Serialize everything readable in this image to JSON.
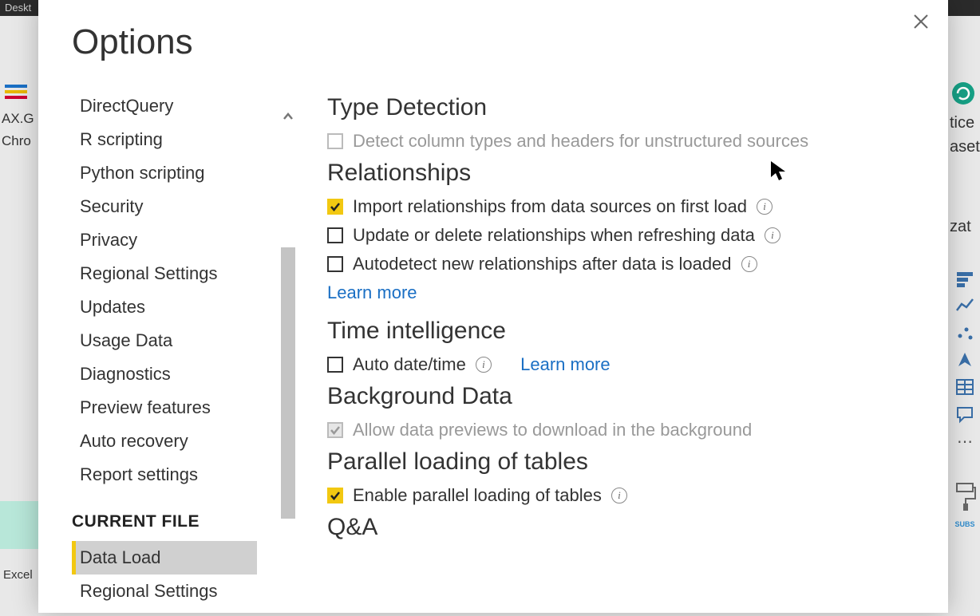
{
  "bg": {
    "titlebar": "Deskt",
    "left_lines": [
      "AX.G",
      "Chro"
    ],
    "excel_label": "Excel",
    "right_lines": [
      "tice",
      "aset",
      "zat"
    ]
  },
  "dialog": {
    "title": "Options",
    "sidebar": {
      "items": [
        "DirectQuery",
        "R scripting",
        "Python scripting",
        "Security",
        "Privacy",
        "Regional Settings",
        "Updates",
        "Usage Data",
        "Diagnostics",
        "Preview features",
        "Auto recovery",
        "Report settings"
      ],
      "section_header": "CURRENT FILE",
      "current_items": [
        "Data Load",
        "Regional Settings"
      ],
      "selected": "Data Load"
    },
    "content": {
      "type_detection": {
        "heading": "Type Detection",
        "opt1": "Detect column types and headers for unstructured sources"
      },
      "relationships": {
        "heading": "Relationships",
        "opt1": "Import relationships from data sources on first load",
        "opt2": "Update or delete relationships when refreshing data",
        "opt3": "Autodetect new relationships after data is loaded",
        "learn_more": "Learn more"
      },
      "time_intel": {
        "heading": "Time intelligence",
        "opt1": "Auto date/time",
        "learn_more": "Learn more"
      },
      "background": {
        "heading": "Background Data",
        "opt1": "Allow data previews to download in the background"
      },
      "parallel": {
        "heading": "Parallel loading of tables",
        "opt1": "Enable parallel loading of tables"
      },
      "qa": {
        "heading": "Q&A"
      }
    }
  }
}
